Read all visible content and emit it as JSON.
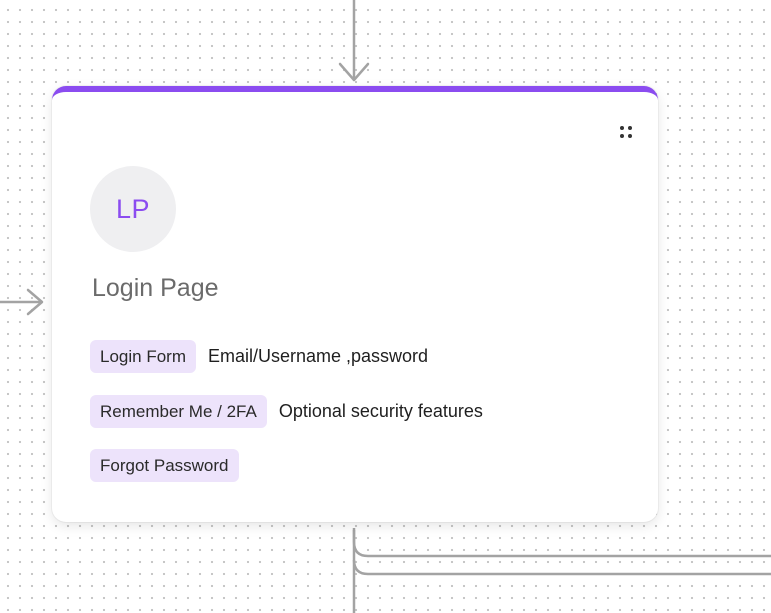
{
  "node": {
    "avatar_initials": "LP",
    "title": "Login Page",
    "accent_color": "#8b4cf0",
    "tag_background": "#ede3fb",
    "handle_icon": "drag-handle-icon",
    "features": [
      {
        "tag": "Login Form",
        "description": "Email/Username ,password"
      },
      {
        "tag": "Remember Me / 2FA",
        "description": "Optional security features"
      },
      {
        "tag": "Forgot Password",
        "description": ""
      }
    ]
  }
}
